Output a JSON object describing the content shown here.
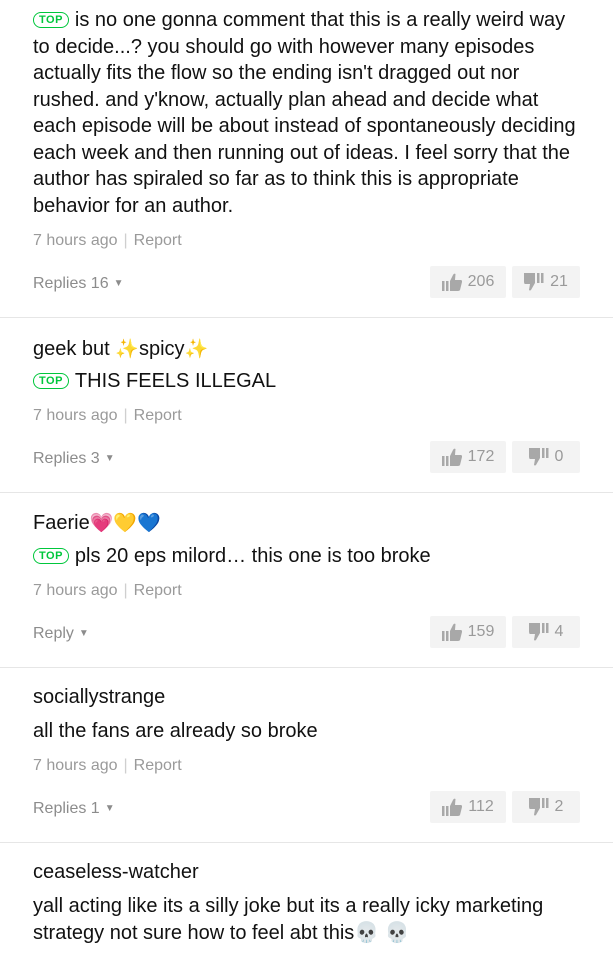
{
  "comments": [
    {
      "author": "",
      "top": true,
      "top_label": "TOP",
      "body": "is no one gonna comment that this is a really weird way to decide...? you should go with however many episodes actually fits the flow so the ending isn't dragged out nor rushed. and y'know, actually plan ahead and decide what each episode will be about instead of spontaneously deciding each week and then running out of ideas. I feel sorry that the author has spiraled so far as to think this is appropriate behavior for an author.",
      "time": "7 hours ago",
      "report": "Report",
      "replies": "Replies 16",
      "likes": "206",
      "dislikes": "21"
    },
    {
      "author": "geek but",
      "author_mid": "spicy",
      "author_emoji": "✨",
      "top": true,
      "top_label": "TOP",
      "body": "THIS FEELS ILLEGAL",
      "time": "7 hours ago",
      "report": "Report",
      "replies": "Replies 3",
      "likes": "172",
      "dislikes": "0"
    },
    {
      "author": "Faerie",
      "author_emoji": "💗💛💙",
      "top": true,
      "top_label": "TOP",
      "body": "pls 20 eps milord… this one is too broke",
      "time": "7 hours ago",
      "report": "Report",
      "replies": "Reply",
      "likes": "159",
      "dislikes": "4"
    },
    {
      "author": "sociallystrange",
      "top": false,
      "body": "all the fans are already so broke",
      "time": "7 hours ago",
      "report": "Report",
      "replies": "Replies 1",
      "likes": "112",
      "dislikes": "2"
    },
    {
      "author": "ceaseless-watcher",
      "top": false,
      "body": "yall acting like its a silly joke but its a really icky marketing strategy not sure how to feel abt this",
      "body_emoji": "💀 💀"
    }
  ],
  "colors": {
    "accent": "#00c73c",
    "muted": "#9a9a9a",
    "vote_bg": "#f3f3f3"
  }
}
